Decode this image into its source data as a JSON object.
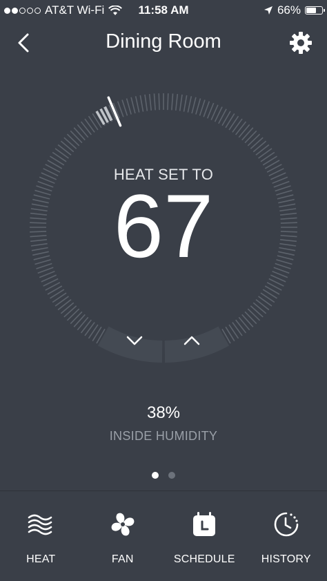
{
  "status_bar": {
    "carrier": "AT&T Wi-Fi",
    "time": "11:58 AM",
    "battery": "66%",
    "battery_level": 0.66,
    "signal_bars": 2,
    "signal_total": 5,
    "icons": [
      "wifi-icon",
      "location-icon",
      "battery-icon"
    ]
  },
  "header": {
    "title": "Dining Room",
    "back_icon": "chevron-left-icon",
    "settings_icon": "gear-icon"
  },
  "thermostat": {
    "mode_label": "HEAT SET TO",
    "setpoint": "67",
    "down_icon": "chevron-down-icon",
    "up_icon": "chevron-up-icon"
  },
  "humidity": {
    "value": "38%",
    "label": "INSIDE HUMIDITY"
  },
  "pager": {
    "count": 2,
    "active": 0
  },
  "tabs": [
    {
      "label": "HEAT",
      "icon": "heat-waves-icon"
    },
    {
      "label": "FAN",
      "icon": "fan-icon"
    },
    {
      "label": "SCHEDULE",
      "icon": "calendar-clock-icon"
    },
    {
      "label": "HISTORY",
      "icon": "history-clock-icon"
    }
  ],
  "colors": {
    "background": "#3a3f48",
    "tick": "#5d636c",
    "tick_highlight": "#ffffff",
    "button_bg": "#444a53"
  }
}
